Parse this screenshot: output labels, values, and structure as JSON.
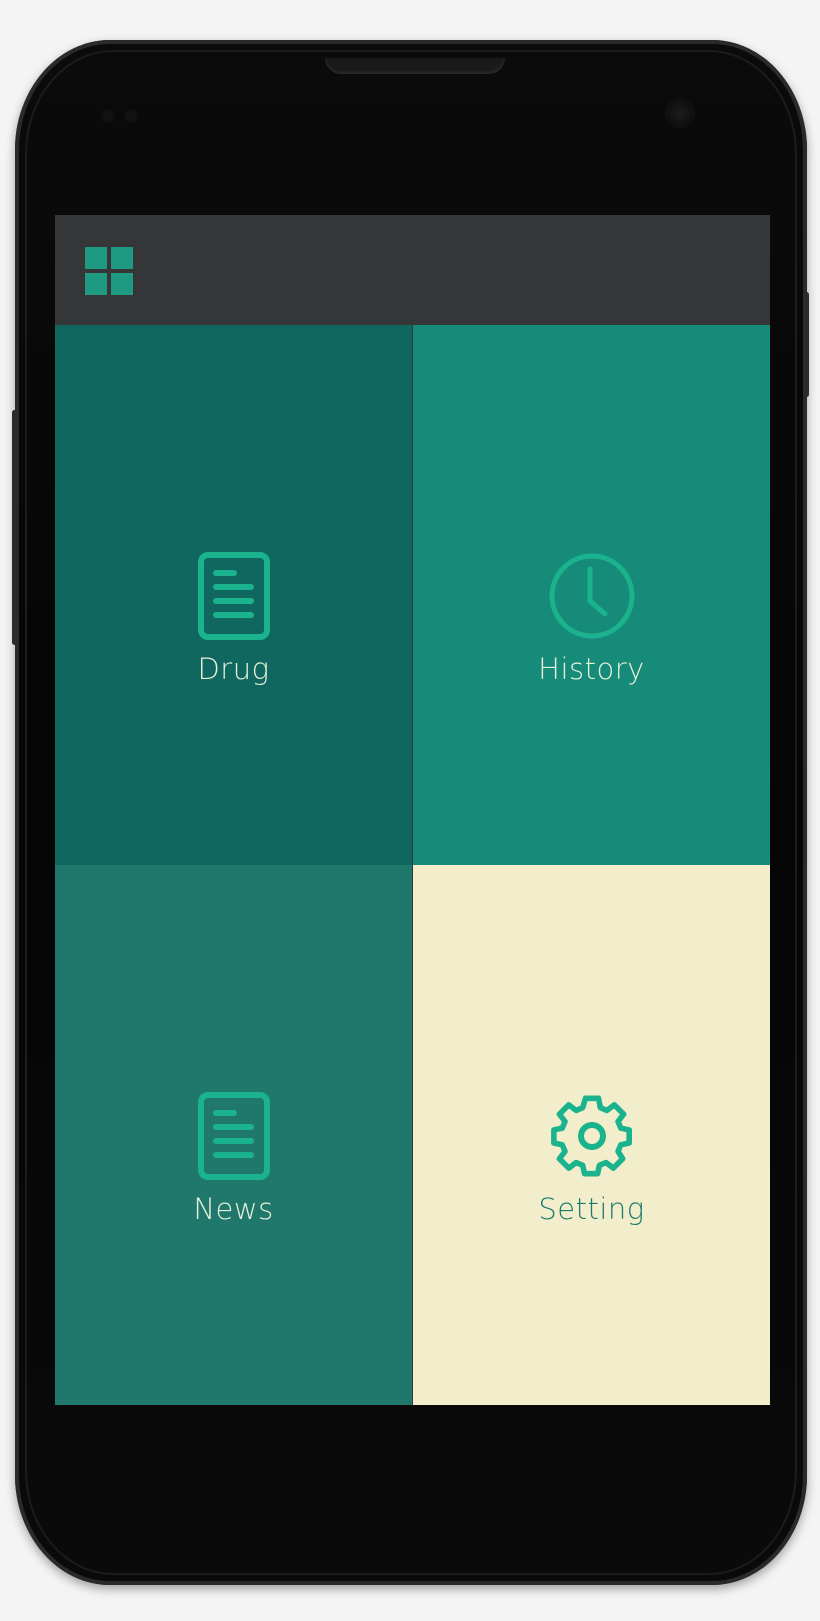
{
  "app": {
    "menu_icon": "grid-menu-icon",
    "colors": {
      "appbar": "#353637",
      "accent": "#1ab38d",
      "drug_tile": "#0f675f",
      "history_tile": "#178b79",
      "news_tile": "#1f786b",
      "setting_tile": "#f2eecc",
      "light_label": "#e7f0d9",
      "dark_label": "#1c7a6c"
    }
  },
  "tiles": [
    {
      "label": "Drug",
      "icon": "document-icon"
    },
    {
      "label": "History",
      "icon": "clock-icon"
    },
    {
      "label": "News",
      "icon": "document-icon"
    },
    {
      "label": "Setting",
      "icon": "gear-icon"
    }
  ]
}
